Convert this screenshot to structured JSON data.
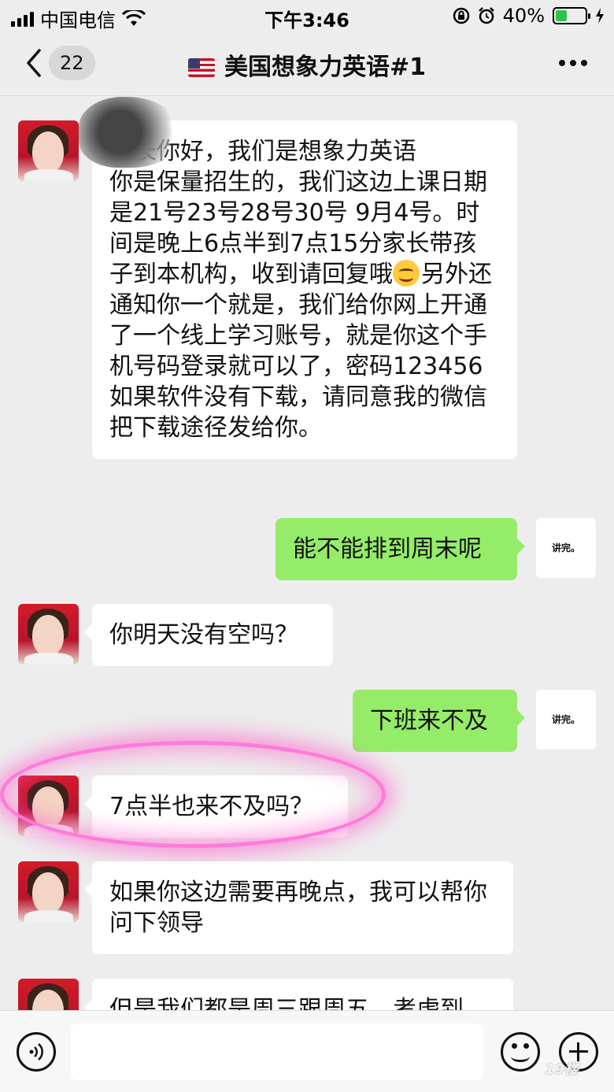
{
  "status_bar": {
    "carrier": "中国电信",
    "time": "下午3:46",
    "battery": "40%",
    "battery_level": 0.4
  },
  "nav": {
    "back_count": "22",
    "title": "美国想象力英语#1"
  },
  "messages": [
    {
      "side": "in",
      "text": "家长你好，我们是想象力英语\n你是保量招生的，我们这边上课日期是21号23号28号30号 9月4号。时间是晚上6点半到7点15分家长带孩子到本机构，收到请回复哦",
      "text_after_emoji": "另外还通知你一个就是，我们给你网上开通了一个线上学习账号，就是你这个手机号码登录就可以了，密码123456如果软件没有下载，请同意我的微信把下载途径发给你。"
    },
    {
      "side": "out",
      "text": "能不能排到周末呢",
      "sticker": "讲完。"
    },
    {
      "side": "in",
      "text": "你明天没有空吗？"
    },
    {
      "side": "out",
      "text": "下班来不及",
      "sticker": "讲完。"
    },
    {
      "side": "in",
      "text": "7点半也来不及吗？"
    },
    {
      "side": "in",
      "text": "如果你这边需要再晚点，我可以帮你问下领导"
    },
    {
      "side": "in",
      "text": "但是我们都是周三跟周五，考虑到"
    }
  ],
  "input": {
    "placeholder": ""
  },
  "watermark": "19楼"
}
